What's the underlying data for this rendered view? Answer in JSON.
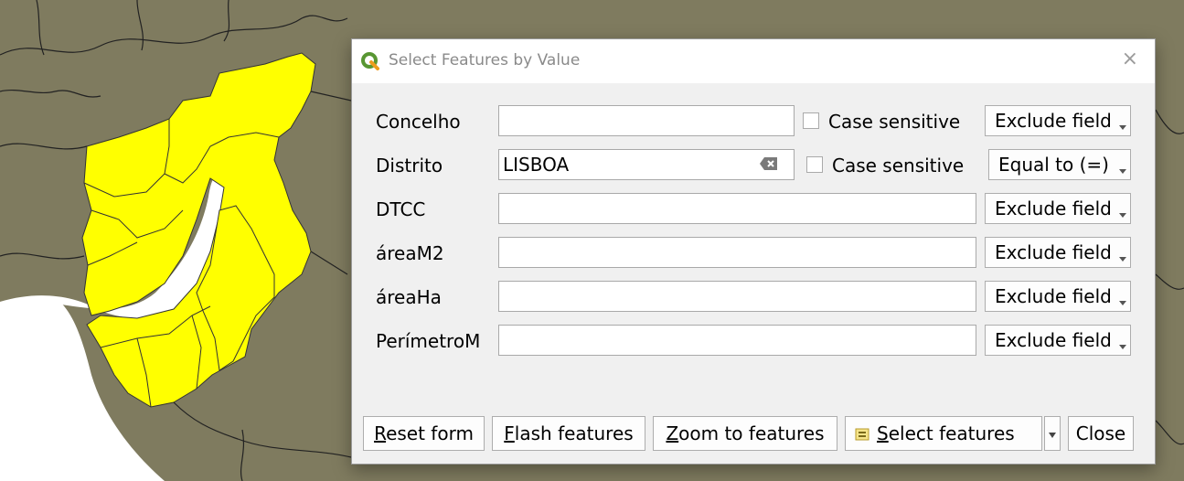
{
  "dialog": {
    "title": "Select Features by Value",
    "close_symbol": "×",
    "icon": "qgis-logo-icon"
  },
  "fields": [
    {
      "label": "Concelho",
      "value": "",
      "case_sensitive_label": "Case sensitive",
      "case_sensitive_checked": false,
      "operator": "Exclude field"
    },
    {
      "label": "Distrito",
      "value": "LISBOA",
      "case_sensitive_label": "Case sensitive",
      "case_sensitive_checked": false,
      "operator": "Equal to (=)"
    },
    {
      "label": "DTCC",
      "value": "",
      "operator": "Exclude field"
    },
    {
      "label": "áreaM2",
      "value": "",
      "operator": "Exclude field"
    },
    {
      "label": "áreaHa",
      "value": "",
      "operator": "Exclude field"
    },
    {
      "label": "PerímetroM",
      "value": "",
      "operator": "Exclude field"
    }
  ],
  "buttons": {
    "reset": {
      "mnemonic": "R",
      "rest": "eset form"
    },
    "flash": {
      "mnemonic": "F",
      "rest": "lash features"
    },
    "zoom": {
      "mnemonic": "Z",
      "rest": "oom to features"
    },
    "select": {
      "mnemonic": "S",
      "rest": "elect features"
    },
    "close": "Close"
  },
  "colors": {
    "map_background": "#7f7b5f",
    "selected_feature": "#ffff00",
    "water": "#ffffff"
  }
}
